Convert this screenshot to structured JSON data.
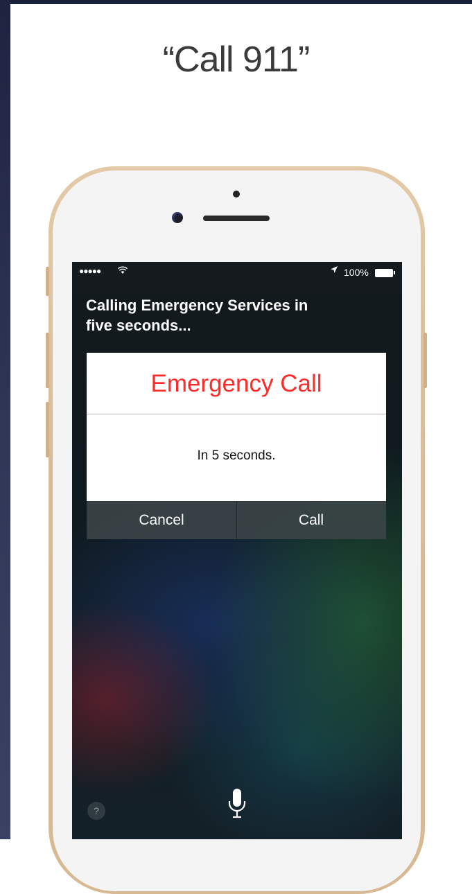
{
  "headline": "“Call 911”",
  "status_bar": {
    "signal": "●●●●●",
    "wifi_icon": "wifi-icon",
    "location_icon": "location-arrow-icon",
    "battery_percent": "100%"
  },
  "siri": {
    "message_line1": "Calling Emergency Services in",
    "message_line2": "five seconds..."
  },
  "card": {
    "title": "Emergency Call",
    "message": "In 5 seconds.",
    "cancel_label": "Cancel",
    "call_label": "Call"
  },
  "bottom": {
    "help_label": "?",
    "mic_icon": "microphone-icon"
  },
  "colors": {
    "title_red": "#ff2b2b",
    "phone_gold": "#d9bc97"
  }
}
